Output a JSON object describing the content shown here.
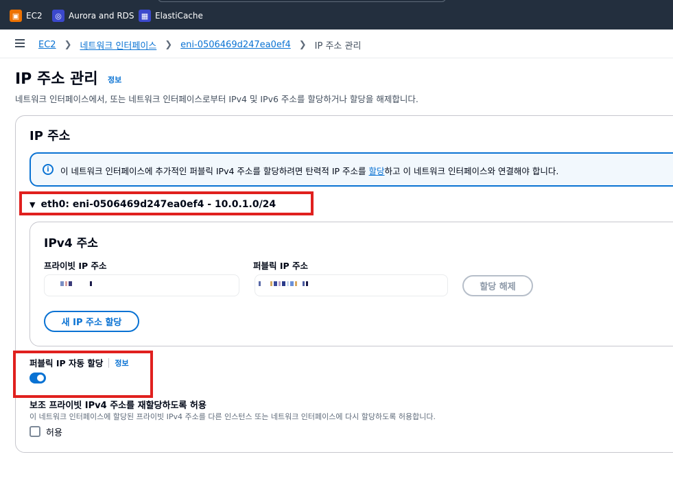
{
  "services": [
    {
      "label": "EC2",
      "icon": "ec2-icon",
      "color": "#ed7100"
    },
    {
      "label": "Aurora and RDS",
      "icon": "rds-icon",
      "color": "#3b48cc"
    },
    {
      "label": "ElastiCache",
      "icon": "elasticache-icon",
      "color": "#3b48cc"
    }
  ],
  "breadcrumb": {
    "items": [
      "EC2",
      "네트워크 인터페이스",
      "eni-0506469d247ea0ef4"
    ],
    "current": "IP 주소 관리"
  },
  "header": {
    "title": "IP 주소 관리",
    "info": "정보",
    "description": "네트워크 인터페이스에서, 또는 네트워크 인터페이스로부터 IPv4 및 IPv6 주소를 할당하거나 할당을 해제합니다."
  },
  "ip_section": {
    "title": "IP 주소",
    "alert": {
      "text_before": "이 네트워크 인터페이스에 추가적인 퍼블릭 IPv4 주소를 할당하려면 탄력적 IP 주소를 ",
      "link": "할당",
      "text_after": "하고 이 네트워크 인터페이스와 연결해야 합니다."
    },
    "interface_label": "eth0: eni-0506469d247ea0ef4 - 10.0.1.0/24",
    "ipv4": {
      "title": "IPv4 주소",
      "private_label": "프라이빗 IP 주소",
      "public_label": "퍼블릭 IP 주소",
      "unassign_button": "할당 해제",
      "new_button": "새 IP 주소 할당"
    },
    "auto_assign": {
      "label": "퍼블릭 IP 자동 할당",
      "info": "정보",
      "enabled": true
    },
    "reassign": {
      "title": "보조 프라이빗 IPv4 주소를 재할당하도록 허용",
      "description": "이 네트워크 인터페이스에 할당된 프라이빗 IPv4 주소를 다른 인스턴스 또는 네트워크 인터페이스에 다시 할당하도록 허용합니다.",
      "checkbox_label": "허용",
      "checked": false
    }
  },
  "colors": {
    "accent": "#0972d3",
    "highlight": "#e0201e",
    "topbar": "#232f3e"
  }
}
